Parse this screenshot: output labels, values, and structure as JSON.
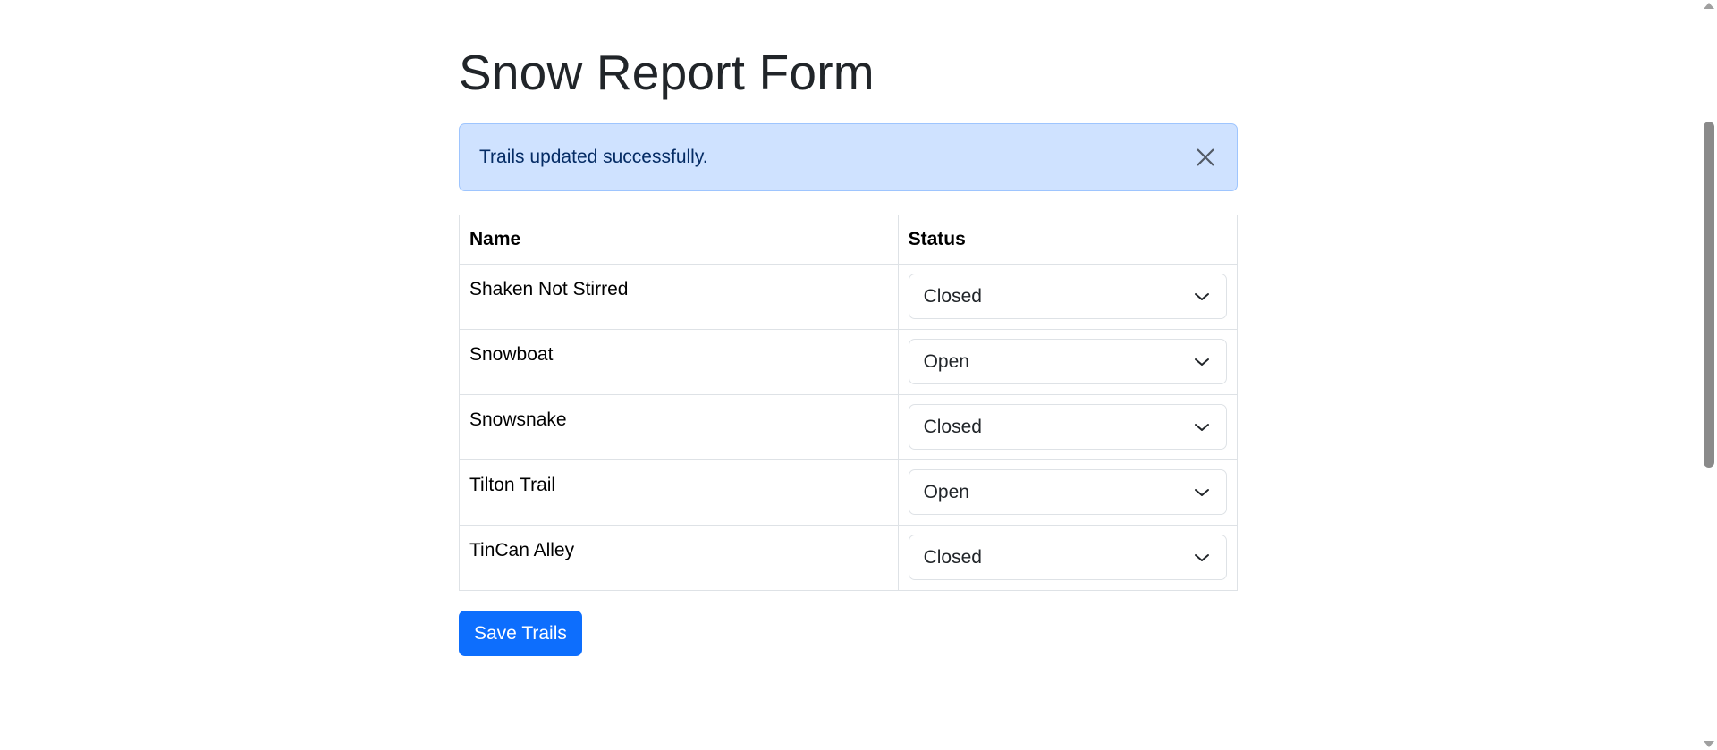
{
  "page": {
    "title": "Snow Report Form"
  },
  "alert": {
    "message": "Trails updated successfully.",
    "close_icon": "close-icon"
  },
  "table": {
    "headers": {
      "name": "Name",
      "status": "Status"
    },
    "rows": [
      {
        "name": "Shaken Not Stirred",
        "status": "Closed"
      },
      {
        "name": "Snowboat",
        "status": "Open"
      },
      {
        "name": "Snowsnake",
        "status": "Closed"
      },
      {
        "name": "Tilton Trail",
        "status": "Open"
      },
      {
        "name": "TinCan Alley",
        "status": "Closed"
      }
    ]
  },
  "actions": {
    "save_label": "Save Trails"
  },
  "colors": {
    "alert_bg": "#cfe2ff",
    "alert_text": "#052c65",
    "primary": "#0d6efd"
  }
}
